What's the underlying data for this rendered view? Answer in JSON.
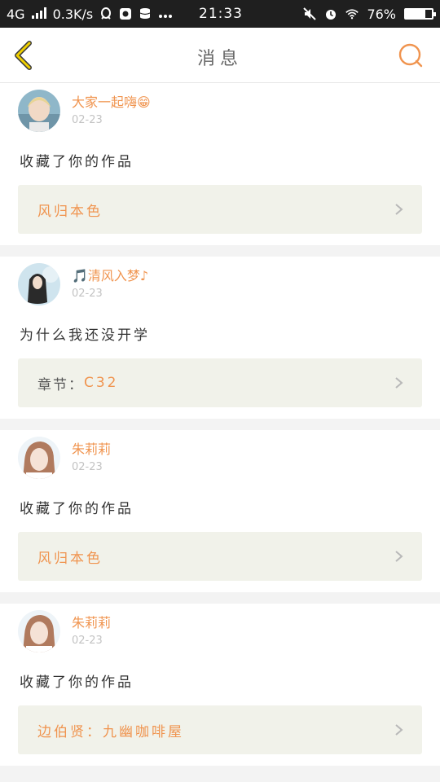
{
  "status_bar": {
    "network": "4G",
    "speed": "0.3K/s",
    "time": "21:33",
    "battery_pct": "76%",
    "battery_level": 0.76
  },
  "nav": {
    "title": "消息"
  },
  "colors": {
    "accent": "#f0944f",
    "back_icon": "#e8b400",
    "ref_bg": "#f1f2ea"
  },
  "messages": [
    {
      "username": "大家一起嗨😁",
      "date": "02-23",
      "text": "收藏了你的作品",
      "ref_label": "",
      "ref_value": "风归本色"
    },
    {
      "username": "🎵清风入梦♪",
      "date": "02-23",
      "text": "为什么我还没开学",
      "ref_label": "章节：",
      "ref_value": "C32"
    },
    {
      "username": "朱莉莉",
      "date": "02-23",
      "text": "收藏了你的作品",
      "ref_label": "",
      "ref_value": "风归本色"
    },
    {
      "username": "朱莉莉",
      "date": "02-23",
      "text": "收藏了你的作品",
      "ref_label": "",
      "ref_value": "边伯贤：九幽咖啡屋"
    }
  ]
}
